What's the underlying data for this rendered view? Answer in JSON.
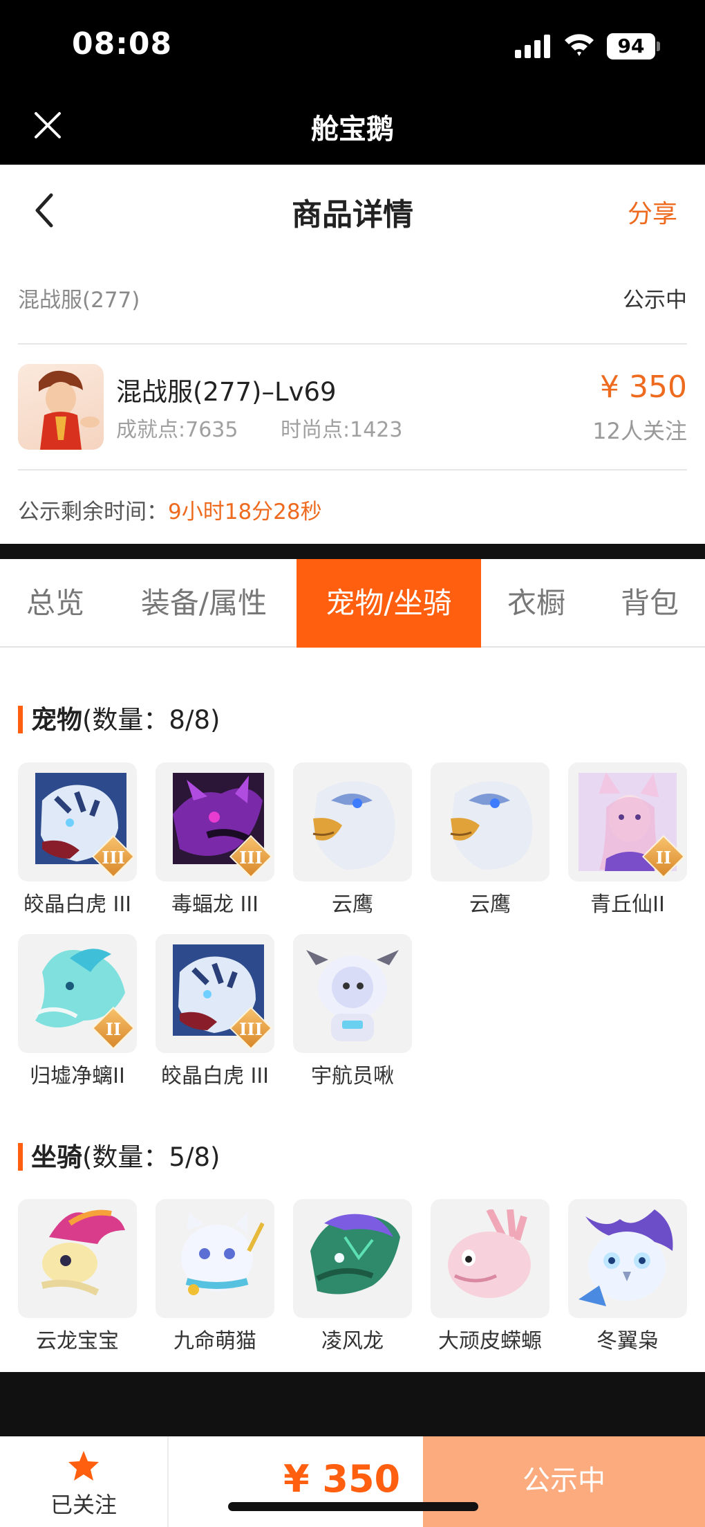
{
  "status_bar": {
    "time": "08:08",
    "battery": "94"
  },
  "app_bar": {
    "title": "舱宝鹅"
  },
  "nav": {
    "title": "商品详情",
    "share": "分享"
  },
  "listing": {
    "server": "混战服(277)",
    "status": "公示中",
    "name": "混战服(277)–Lv69",
    "achievement": "成就点:7635",
    "fashion": "时尚点:1423",
    "price": "¥ 350",
    "followers": "12人关注",
    "remaining_label": "公示剩余时间：",
    "remaining_value": "9小时18分28秒"
  },
  "tabs": [
    {
      "label": "总览",
      "active": false
    },
    {
      "label": "装备/属性",
      "active": false
    },
    {
      "label": "宠物/坐骑",
      "active": true
    },
    {
      "label": "衣橱",
      "active": false
    },
    {
      "label": "背包",
      "active": false
    }
  ],
  "pets": {
    "title": "宠物",
    "count": "(数量：8/8)",
    "items": [
      {
        "name": "皎晶白虎 III",
        "badge": "III",
        "icon": "white-tiger-icon"
      },
      {
        "name": "毒蝠龙 III",
        "badge": "III",
        "icon": "poison-bat-dragon-icon"
      },
      {
        "name": "云鹰",
        "badge": "",
        "icon": "cloud-eagle-icon"
      },
      {
        "name": "云鹰",
        "badge": "",
        "icon": "cloud-eagle-icon"
      },
      {
        "name": "青丘仙II",
        "badge": "II",
        "icon": "fox-fairy-icon"
      },
      {
        "name": "归墟净螭II",
        "badge": "II",
        "icon": "water-dragon-icon"
      },
      {
        "name": "皎晶白虎 III",
        "badge": "III",
        "icon": "white-tiger-icon"
      },
      {
        "name": "宇航员啾",
        "badge": "",
        "icon": "astronaut-pet-icon"
      }
    ]
  },
  "mounts": {
    "title": "坐骑",
    "count": "(数量：5/8)",
    "items": [
      {
        "name": "云龙宝宝",
        "icon": "baby-cloud-dragon-icon"
      },
      {
        "name": "九命萌猫",
        "icon": "cute-cat-icon"
      },
      {
        "name": "凌风龙",
        "icon": "wind-dragon-icon"
      },
      {
        "name": "大顽皮蝾螈",
        "icon": "salamander-icon"
      },
      {
        "name": "冬翼枭",
        "icon": "winter-owl-icon"
      }
    ]
  },
  "bottom": {
    "follow_label": "已关注",
    "price": "¥ 350",
    "action": "公示中"
  },
  "colors": {
    "accent": "#ff5f0f",
    "accent_text": "#ee6a1e",
    "action_bg": "#fbab7d"
  }
}
